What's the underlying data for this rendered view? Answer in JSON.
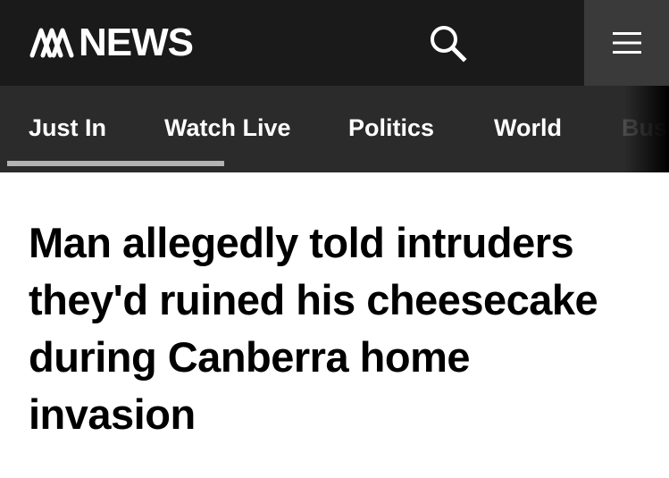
{
  "header": {
    "logo_text": "NEWS",
    "logo_icon": "abc-logo-icon",
    "search_icon": "search-icon",
    "menu_icon": "hamburger-menu-icon",
    "background_color": "#1a1a1a",
    "menu_background_color": "#3a3a3a"
  },
  "nav": {
    "items": [
      {
        "label": "Just In",
        "active": true
      },
      {
        "label": "Watch Live"
      },
      {
        "label": "Politics"
      },
      {
        "label": "World"
      },
      {
        "label": "Business"
      }
    ],
    "background_color": "#2b2b2b",
    "active_indicator_color": "#b3b3b3"
  },
  "article": {
    "headline": "Man allegedly told intruders they'd ruined his cheesecake during Canberra home invasion"
  }
}
